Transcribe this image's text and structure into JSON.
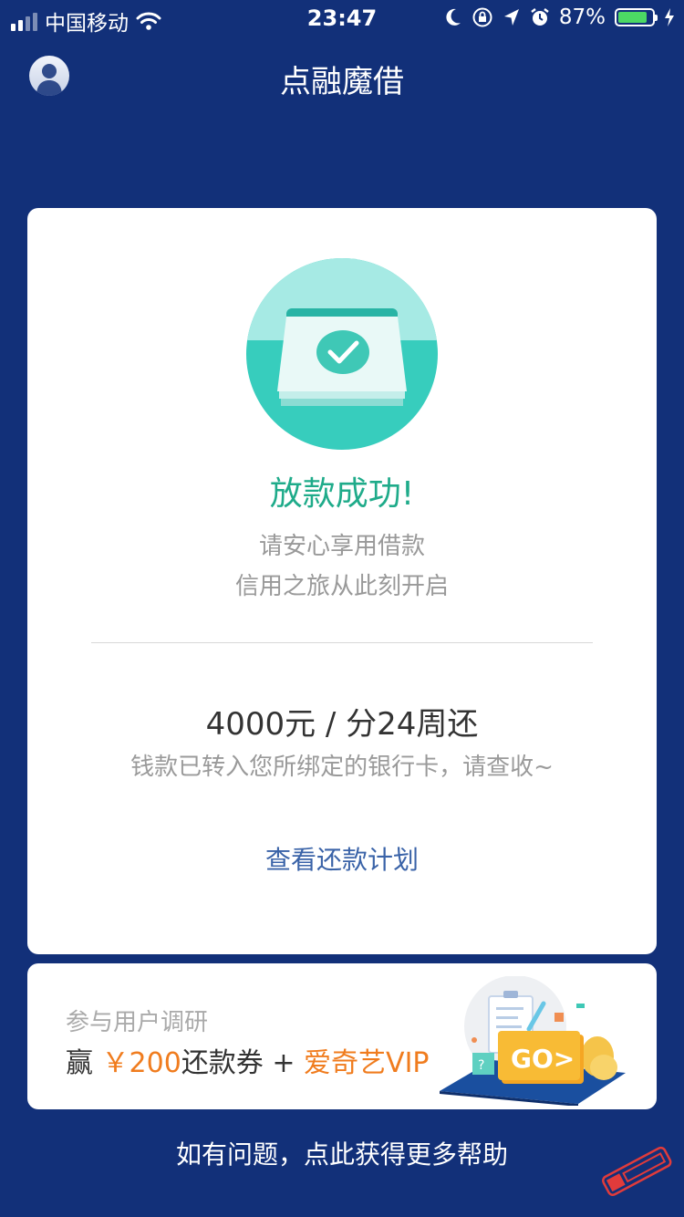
{
  "status_bar": {
    "carrier": "中国移动",
    "time": "23:47",
    "battery_percent_text": "87%",
    "battery_level": 0.87
  },
  "header": {
    "title": "点融魔借"
  },
  "result": {
    "title": "放款成功!",
    "subtitle_line1": "请安心享用借款",
    "subtitle_line2": "信用之旅从此刻开启",
    "loan_summary": "4000元 / 分24周还",
    "transfer_note": "钱款已转入您所绑定的银行卡，请查收~",
    "repay_plan_link": "查看还款计划"
  },
  "survey": {
    "title": "参与用户调研",
    "reward_prefix": "赢",
    "reward_amount": "￥200",
    "reward_mid": "还款券",
    "reward_plus": "+",
    "reward_vip": "爱奇艺VIP",
    "go_label": "GO>"
  },
  "footer": {
    "help_link": "如有问题，点此获得更多帮助"
  },
  "icons": {
    "avatar": "user-avatar-icon",
    "success": "receipt-check-icon",
    "wifi": "wifi-icon",
    "moon": "moon-icon",
    "rotation_lock": "rotation-lock-icon",
    "location": "location-arrow-icon",
    "alarm": "alarm-icon",
    "charging": "charging-bolt-icon"
  },
  "colors": {
    "background": "#123079",
    "success_green": "#1fab8a",
    "link_blue": "#3a63a8",
    "reward_orange": "#f07c1e",
    "battery_green": "#4cd964"
  }
}
